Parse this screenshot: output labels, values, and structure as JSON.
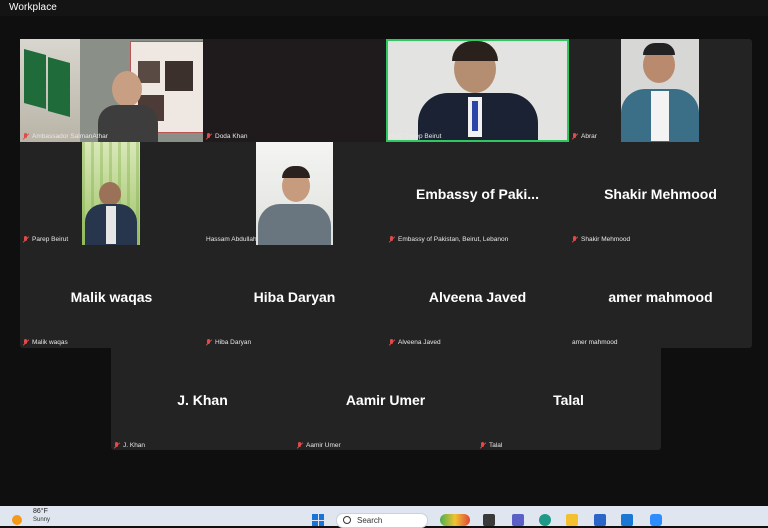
{
  "app": {
    "title": "Workplace"
  },
  "tiles_row1": [
    {
      "name": "Ambassador SalmanAthar",
      "display": "",
      "muted": true
    },
    {
      "name": "Doda Khan",
      "display": "",
      "muted": true
    },
    {
      "name": "HOC Parep Beirut",
      "display": "",
      "muted": false,
      "active": true
    },
    {
      "name": "Abrar",
      "display": "",
      "muted": true
    }
  ],
  "tiles_row2": [
    {
      "name": "Parep Beirut",
      "display": "",
      "muted": true
    },
    {
      "name": "Hassam Abdullah",
      "display": "",
      "muted": false
    },
    {
      "name": "Embassy of Pakistan, Beirut, Lebanon",
      "display": "Embassy of Paki...",
      "muted": true
    },
    {
      "name": "Shakir Mehmood",
      "display": "Shakir Mehmood",
      "muted": true
    }
  ],
  "tiles_row3": [
    {
      "name": "Malik waqas",
      "display": "Malik waqas",
      "muted": true
    },
    {
      "name": "Hiba Daryan",
      "display": "Hiba Daryan",
      "muted": true
    },
    {
      "name": "Alveena Javed",
      "display": "Alveena Javed",
      "muted": true
    },
    {
      "name": "amer mahmood",
      "display": "amer mahmood",
      "muted": false
    }
  ],
  "tiles_row4": [
    {
      "name": "J. Khan",
      "display": "J. Khan",
      "muted": true
    },
    {
      "name": "Aamir Umer",
      "display": "Aamir Umer",
      "muted": true
    },
    {
      "name": "Talal",
      "display": "Talal",
      "muted": true
    }
  ],
  "taskbar": {
    "temperature": "86°F",
    "condition": "Sunny",
    "search_label": "Search"
  }
}
